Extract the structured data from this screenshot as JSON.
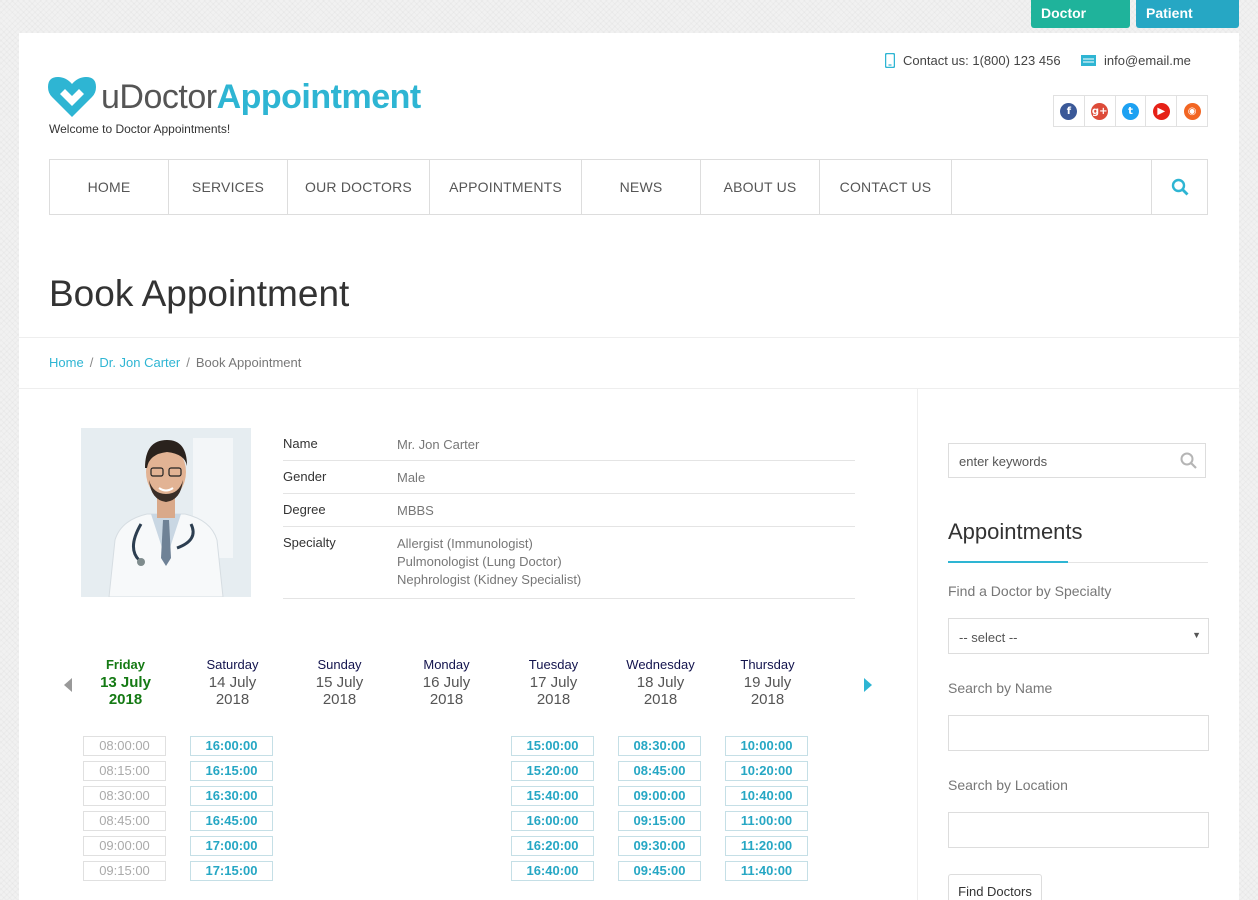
{
  "top_links": {
    "doctor_login": "Doctor Login",
    "patient_login": "Patient Login"
  },
  "header": {
    "logo_plain": "uDoctor",
    "logo_accent": "Appointment",
    "tagline": "Welcome to Doctor Appointments!",
    "contact_phone": "Contact us: 1(800) 123 456",
    "contact_email": "info@email.me",
    "social": [
      {
        "name": "facebook-icon",
        "glyph": "f",
        "color": "#3b5998"
      },
      {
        "name": "google-plus-icon",
        "glyph": "g+",
        "color": "#dd4b39"
      },
      {
        "name": "twitter-icon",
        "glyph": "t",
        "color": "#1da1f2"
      },
      {
        "name": "youtube-icon",
        "glyph": "▶",
        "color": "#e62117"
      },
      {
        "name": "rss-icon",
        "glyph": "◉",
        "color": "#f26522"
      }
    ]
  },
  "nav": {
    "items": [
      "HOME",
      "SERVICES",
      "OUR DOCTORS",
      "APPOINTMENTS",
      "NEWS",
      "ABOUT US",
      "CONTACT US"
    ]
  },
  "page": {
    "title": "Book Appointment",
    "breadcrumb": [
      "Home",
      "Dr. Jon Carter",
      "Book Appointment"
    ]
  },
  "doctor": {
    "fields": [
      {
        "label": "Name",
        "value": "Mr. Jon Carter"
      },
      {
        "label": "Gender",
        "value": "Male"
      },
      {
        "label": "Degree",
        "value": "MBBS"
      },
      {
        "label": "Specialty",
        "values": [
          "Allergist (Immunologist)",
          "Pulmonologist (Lung Doctor)",
          "Nephrologist (Kidney Specialist)"
        ]
      }
    ]
  },
  "calendar": {
    "days": [
      {
        "name": "Friday",
        "date": "13 July",
        "year": "2018",
        "active": true,
        "slots": [
          "08:00:00",
          "08:15:00",
          "08:30:00",
          "08:45:00",
          "09:00:00",
          "09:15:00"
        ],
        "available": false
      },
      {
        "name": "Saturday",
        "date": "14 July",
        "year": "2018",
        "slots": [
          "16:00:00",
          "16:15:00",
          "16:30:00",
          "16:45:00",
          "17:00:00",
          "17:15:00"
        ],
        "available": true
      },
      {
        "name": "Sunday",
        "date": "15 July",
        "year": "2018",
        "slots": [],
        "available": true
      },
      {
        "name": "Monday",
        "date": "16 July",
        "year": "2018",
        "slots": [],
        "available": true
      },
      {
        "name": "Tuesday",
        "date": "17 July",
        "year": "2018",
        "slots": [
          "15:00:00",
          "15:20:00",
          "15:40:00",
          "16:00:00",
          "16:20:00",
          "16:40:00"
        ],
        "available": true
      },
      {
        "name": "Wednesday",
        "date": "18 July",
        "year": "2018",
        "slots": [
          "08:30:00",
          "08:45:00",
          "09:00:00",
          "09:15:00",
          "09:30:00",
          "09:45:00"
        ],
        "available": true
      },
      {
        "name": "Thursday",
        "date": "19 July",
        "year": "2018",
        "slots": [
          "10:00:00",
          "10:20:00",
          "10:40:00",
          "11:00:00",
          "11:20:00",
          "11:40:00"
        ],
        "available": true
      }
    ]
  },
  "sidebar": {
    "keywords_placeholder": "enter keywords",
    "title": "Appointments",
    "specialty_label": "Find a Doctor by Specialty",
    "specialty_value": "-- select --",
    "name_label": "Search by Name",
    "location_label": "Search by Location",
    "find_button": "Find Doctors"
  },
  "colors": {
    "accent": "#2eb5d3",
    "doctor_login": "#1fb39b",
    "patient_login": "#26a7c4",
    "active_day": "#157a14"
  }
}
